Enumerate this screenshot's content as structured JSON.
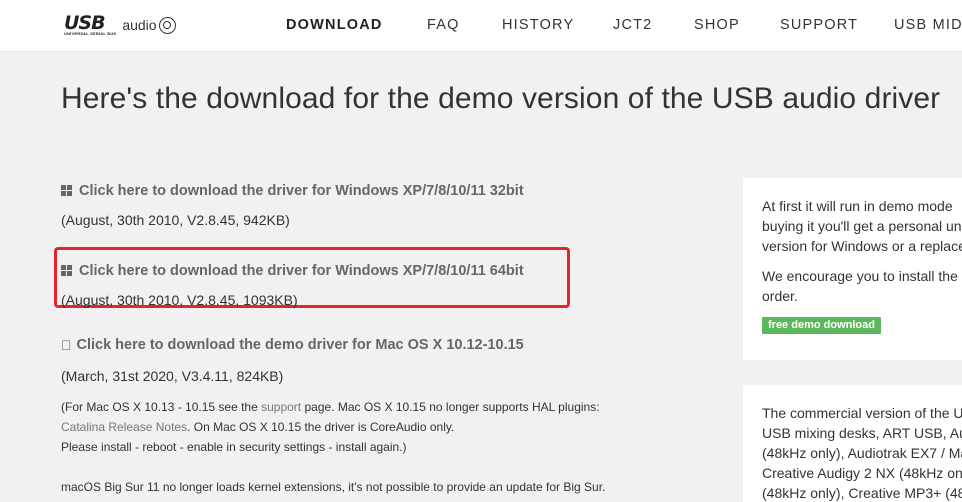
{
  "header": {
    "logo_usb": "USB",
    "logo_sub": "UNIVERSAL SERIAL BUS",
    "logo_audio": "audio",
    "nav": [
      {
        "label": "DOWNLOAD",
        "active": true
      },
      {
        "label": "FAQ",
        "active": false
      },
      {
        "label": "HISTORY",
        "active": false
      },
      {
        "label": "JCT2",
        "active": false
      },
      {
        "label": "SHOP",
        "active": false
      },
      {
        "label": "SUPPORT",
        "active": false
      },
      {
        "label": "USB MIDI",
        "active": false
      }
    ]
  },
  "main": {
    "title": "Here's the download for the demo version of the USB audio driver",
    "downloads": [
      {
        "icon": "windows-icon",
        "link": "Click here to download the driver for Windows XP/7/8/10/11 32bit",
        "meta": "(August, 30th 2010, V2.8.45, 942KB)"
      },
      {
        "icon": "windows-icon",
        "link": "Click here to download the driver for Windows XP/7/8/10/11 64bit",
        "meta": "(August, 30th 2010, V2.8.45, 1093KB)",
        "highlighted": true
      },
      {
        "icon": "apple-icon",
        "link": "Click here to download the demo driver for Mac OS X 10.12-10.15",
        "meta": "(March, 31st 2020, V3.4.11, 824KB)"
      }
    ],
    "mac_note": {
      "line1_pre": "(For Mac OS X 10.13 - 10.15 see the ",
      "line1_link": "support",
      "line1_post": " page. Mac OS X 10.15 no longer supports HAL plugins:",
      "line2_link": "Catalina Release Notes",
      "line2_post": ". On Mac OS X 10.15 the driver is CoreAudio only.",
      "line3": "Please install - reboot - enable in security settings - install again.)"
    },
    "bigsur_note": "macOS Big Sur 11 no longer loads kernel extensions, it's not possible to provide an update for Big Sur."
  },
  "side": {
    "panel1": {
      "lines": [
        "At first it will run in demo mode",
        "buying it you'll get a personal un",
        "version for Windows or a replace"
      ],
      "lines2": [
        "We encourage you to install the",
        "order."
      ],
      "badge": "free demo download"
    },
    "panel2": {
      "lines": [
        "The commercial version of the U",
        "USB mixing desks, ART USB, Aud",
        "(48kHz only), Audiotrak EX7 / Ma",
        "Creative Audigy 2 NX (48kHz onl",
        "(48kHz only), Creative MP3+ (48"
      ]
    }
  },
  "colors": {
    "highlight": "#e3262c",
    "badge": "#5cb85c",
    "link": "#666666"
  }
}
